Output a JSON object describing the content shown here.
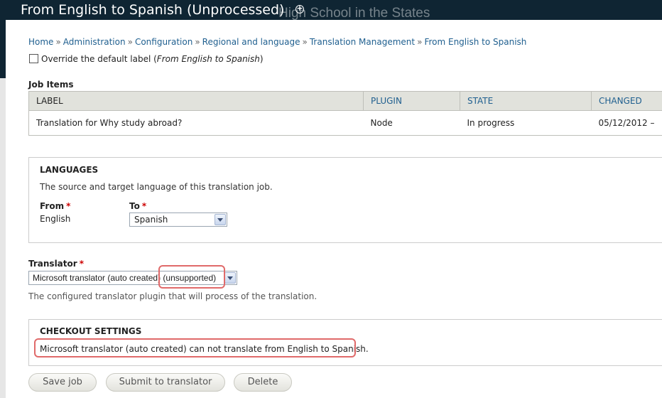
{
  "header": {
    "title": "From English to Spanish (Unprocessed)",
    "site_name_ghost": "High School in the States"
  },
  "breadcrumb": [
    "Home",
    "Administration",
    "Configuration",
    "Regional and language",
    "Translation Management",
    "From English to Spanish"
  ],
  "breadcrumb_separator": "»",
  "override": {
    "label_prefix": "Override the default label (",
    "label_italic": "From English to Spanish",
    "label_suffix": ")",
    "checked": false
  },
  "job_items": {
    "title": "Job Items",
    "columns": [
      "LABEL",
      "PLUGIN",
      "STATE",
      "CHANGED"
    ],
    "rows": [
      [
        "Translation for Why study abroad?",
        "Node",
        "In progress",
        "05/12/2012 –"
      ]
    ]
  },
  "languages": {
    "legend": "LANGUAGES",
    "description": "The source and target language of this translation job.",
    "from_label": "From",
    "from_value": "English",
    "to_label": "To",
    "to_value": "Spanish",
    "required_mark": "*"
  },
  "translator": {
    "label": "Translator",
    "required_mark": "*",
    "value_main": "Microsoft translator (auto created)",
    "value_unsupported": "(unsupported)",
    "description": "The configured translator plugin that will process of the translation."
  },
  "checkout": {
    "legend": "CHECKOUT SETTINGS",
    "message": "Microsoft translator (auto created) can not translate from English to Spanish."
  },
  "buttons": {
    "save": "Save job",
    "submit": "Submit to translator",
    "delete": "Delete"
  },
  "colors": {
    "header_bg": "#0f2533",
    "link": "#1f5f8f",
    "highlight": "#e06a6a",
    "required": "#cc0000"
  },
  "icons": {
    "title_toggle": "plus-circle-icon",
    "select_arrow": "chevron-down-icon"
  }
}
